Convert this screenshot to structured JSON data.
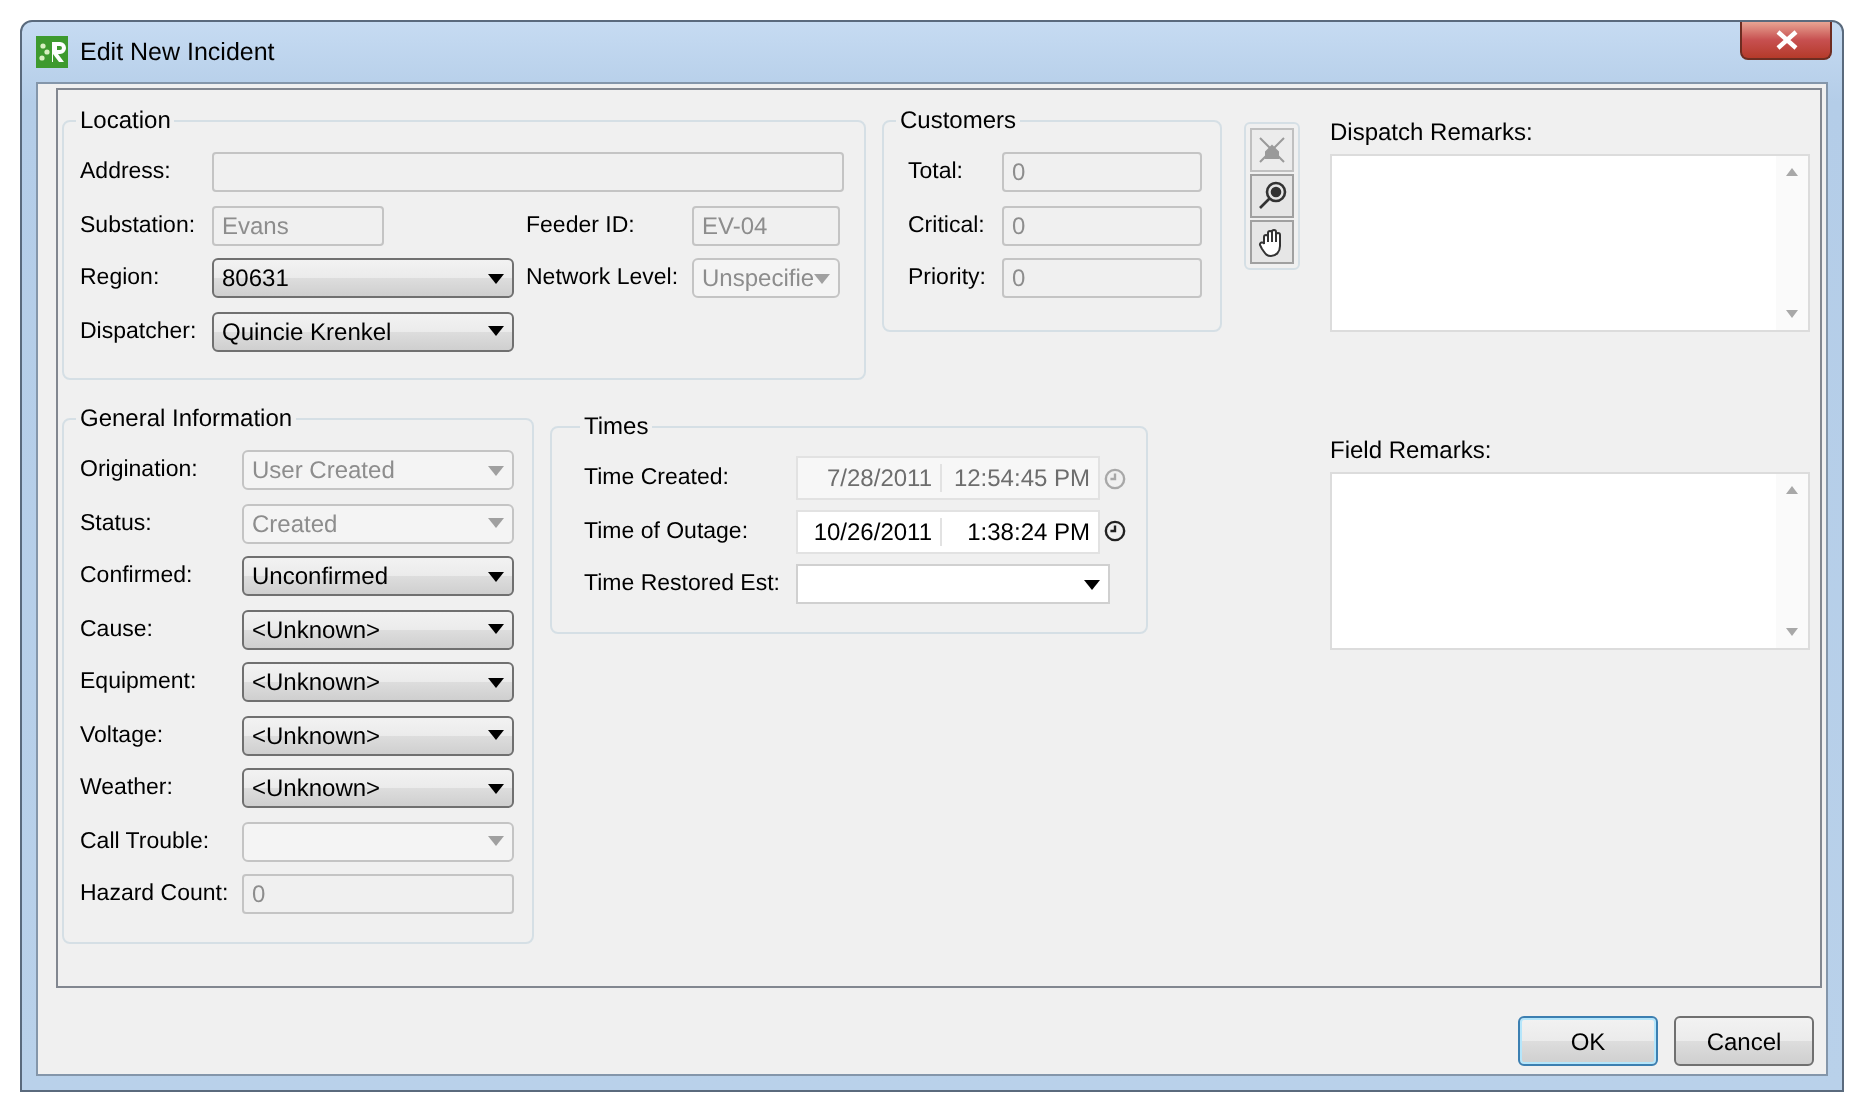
{
  "window": {
    "title": "Edit New Incident"
  },
  "location": {
    "title": "Location",
    "rows": [
      {
        "fields": [
          {
            "label": "Address:",
            "kind": "text",
            "disabled": true
          }
        ]
      },
      {
        "fields": [
          {
            "label": "Substation:",
            "kind": "text",
            "value": "Evans",
            "disabled": true
          },
          {
            "label": "Feeder ID:",
            "kind": "text",
            "value": "EV-04",
            "disabled": true
          }
        ]
      },
      {
        "fields": [
          {
            "label": "Region:",
            "kind": "combo",
            "value": "80631",
            "disabled": false
          },
          {
            "label": "Network Level:",
            "kind": "combo",
            "value": "Unspecifie",
            "disabled": true
          }
        ]
      },
      {
        "fields": [
          {
            "label": "Dispatcher:",
            "kind": "combo",
            "value": "Quincie Krenkel",
            "disabled": false
          }
        ]
      }
    ]
  },
  "customers": {
    "title": "Customers",
    "fields": [
      {
        "label": "Total:",
        "kind": "text",
        "value": "0",
        "disabled": true
      },
      {
        "label": "Critical:",
        "kind": "text",
        "value": "0",
        "disabled": true
      },
      {
        "label": "Priority:",
        "kind": "text",
        "value": "0",
        "disabled": true
      }
    ]
  },
  "tools": [
    {
      "kind": "unlink",
      "disabled": true
    },
    {
      "kind": "locate",
      "disabled": false
    },
    {
      "kind": "hand",
      "disabled": false
    }
  ],
  "general": {
    "title": "General Information",
    "fields": [
      {
        "label": "Origination:",
        "kind": "combo",
        "value": "User Created",
        "disabled": true
      },
      {
        "label": "Status:",
        "kind": "combo",
        "value": "Created",
        "disabled": true
      },
      {
        "label": "Confirmed:",
        "kind": "combo",
        "value": "Unconfirmed",
        "disabled": false
      },
      {
        "label": "Cause:",
        "kind": "combo",
        "value": "<Unknown>",
        "disabled": false
      },
      {
        "label": "Equipment:",
        "kind": "combo",
        "value": "<Unknown>",
        "disabled": false
      },
      {
        "label": "Voltage:",
        "kind": "combo",
        "value": "<Unknown>",
        "disabled": false
      },
      {
        "label": "Weather:",
        "kind": "combo",
        "value": "<Unknown>",
        "disabled": false
      },
      {
        "label": "Call Trouble:",
        "kind": "combo",
        "disabled": true
      },
      {
        "label": "Hazard Count:",
        "kind": "text",
        "value": "0",
        "disabled": true
      }
    ]
  },
  "times": {
    "title": "Times",
    "fields": [
      {
        "label": "Time Created:",
        "kind": "datetime",
        "date": "7/28/2011",
        "time": "12:54:45 PM",
        "disabled": true
      },
      {
        "label": "Time of Outage:",
        "kind": "datetime",
        "date": "10/26/2011",
        "time": "1:38:24 PM",
        "disabled": false
      },
      {
        "label": "Time Restored Est:",
        "kind": "picker",
        "disabled": false
      }
    ]
  },
  "remarks": [
    {
      "label": "Dispatch Remarks:"
    },
    {
      "label": "Field Remarks:"
    }
  ],
  "buttons": [
    {
      "label": "OK",
      "default": true
    },
    {
      "label": "Cancel",
      "default": false
    }
  ]
}
